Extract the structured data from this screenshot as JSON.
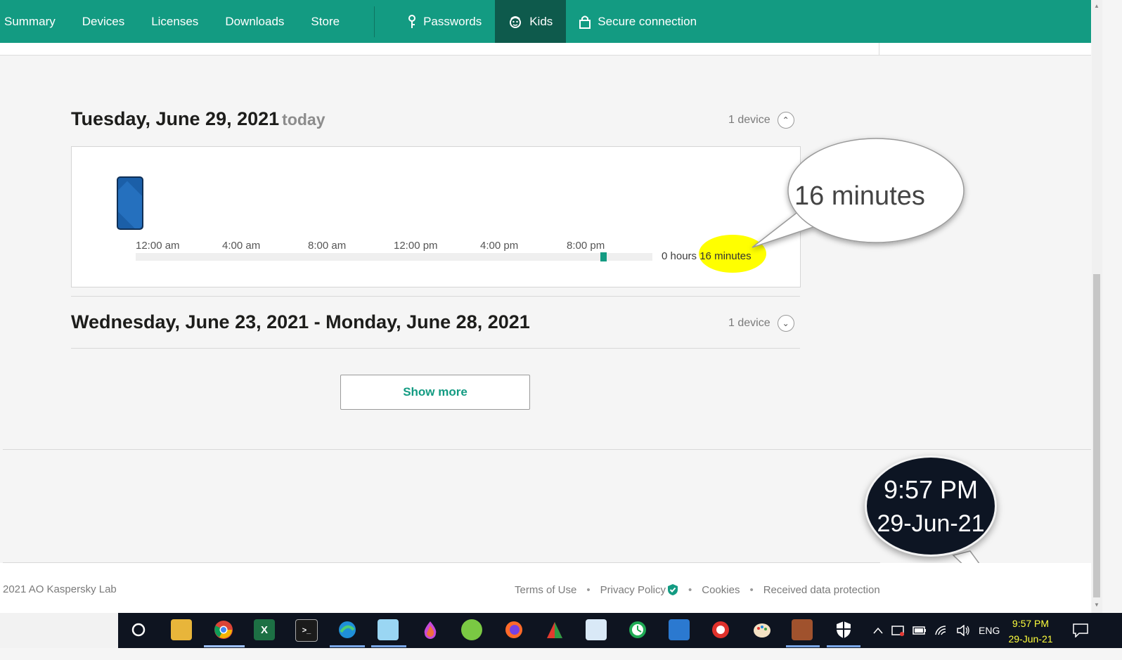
{
  "nav": {
    "items": [
      "Summary",
      "Devices",
      "Licenses",
      "Downloads",
      "Store"
    ],
    "passwords": "Passwords",
    "kids": "Kids",
    "secure": "Secure connection"
  },
  "today_section": {
    "heading": "Tuesday, June 29, 2021",
    "today_tag": "today",
    "device_count": "1 device",
    "time_labels": [
      "12:00 am",
      "4:00 am",
      "8:00 am",
      "12:00 pm",
      "4:00 pm",
      "8:00 pm"
    ],
    "total_prefix": "0 hours",
    "total_minutes": "16 minutes",
    "usage_start_hour": 21.6,
    "usage_end_hour": 21.9
  },
  "range_section": {
    "heading": "Wednesday, June 23, 2021 - Monday, June 28, 2021",
    "device_count": "1 device"
  },
  "show_more": "Show more",
  "callouts": {
    "minutes": "16 minutes",
    "time": "9:57 PM",
    "date": "29-Jun-21"
  },
  "footer": {
    "copyright": "2021 AO Kaspersky Lab",
    "links": [
      "Terms of Use",
      "Privacy Policy",
      "Cookies",
      "Received data protection"
    ]
  },
  "taskbar": {
    "language": "ENG",
    "time": "9:57 PM",
    "date": "29-Jun-21",
    "apps": [
      "cortana-icon",
      "file-explorer-icon",
      "chrome-icon",
      "excel-icon",
      "terminal-icon",
      "edge-icon",
      "notepad-icon",
      "paint-drop-icon",
      "app-green-icon",
      "firefox-icon",
      "app-chart-icon",
      "app-card-icon",
      "app-clock-icon",
      "photos-icon",
      "app-red-icon",
      "paint-icon",
      "app-box-icon",
      "security-icon"
    ]
  },
  "colors": {
    "brand": "#139b82",
    "nav_active": "#0e5a4c",
    "highlight": "#ffff00"
  }
}
